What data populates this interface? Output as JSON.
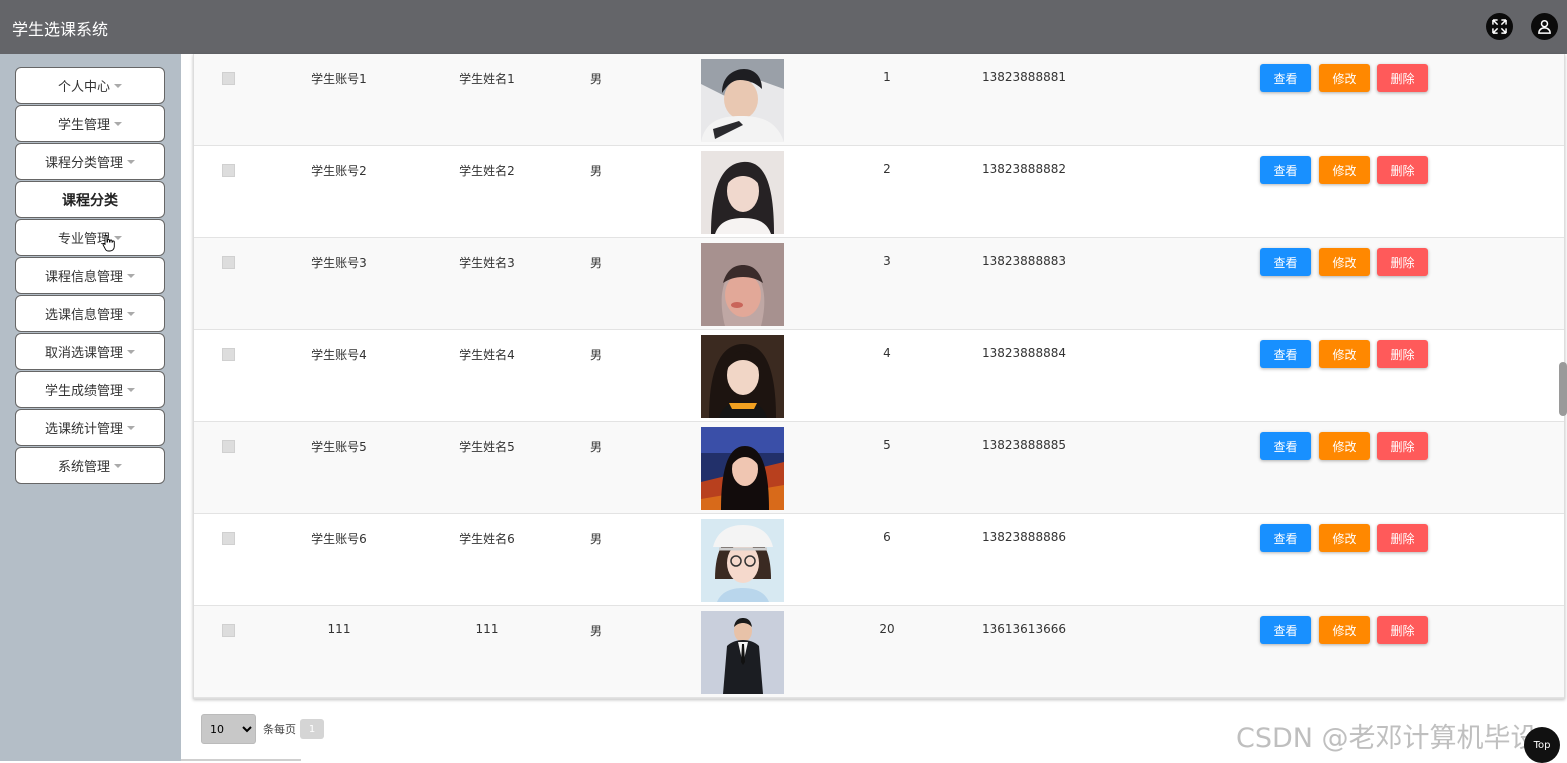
{
  "header": {
    "title": "学生选课系统",
    "fullscreen_icon": "fullscreen-icon",
    "user_icon": "user-icon"
  },
  "sidebar": {
    "items": [
      {
        "label": "个人中心",
        "has_caret": true
      },
      {
        "label": "学生管理",
        "has_caret": true
      },
      {
        "label": "课程分类管理",
        "has_caret": true
      },
      {
        "label": "课程分类",
        "has_caret": false
      },
      {
        "label": "专业管理",
        "has_caret": true
      },
      {
        "label": "课程信息管理",
        "has_caret": true
      },
      {
        "label": "选课信息管理",
        "has_caret": true
      },
      {
        "label": "取消选课管理",
        "has_caret": true
      },
      {
        "label": "学生成绩管理",
        "has_caret": true
      },
      {
        "label": "选课统计管理",
        "has_caret": true
      },
      {
        "label": "系统管理",
        "has_caret": true
      }
    ]
  },
  "table": {
    "rows": [
      {
        "account": "学生账号1",
        "name": "学生姓名1",
        "gender": "男",
        "num": "1",
        "phone": "13823888881"
      },
      {
        "account": "学生账号2",
        "name": "学生姓名2",
        "gender": "男",
        "num": "2",
        "phone": "13823888882"
      },
      {
        "account": "学生账号3",
        "name": "学生姓名3",
        "gender": "男",
        "num": "3",
        "phone": "13823888883"
      },
      {
        "account": "学生账号4",
        "name": "学生姓名4",
        "gender": "男",
        "num": "4",
        "phone": "13823888884"
      },
      {
        "account": "学生账号5",
        "name": "学生姓名5",
        "gender": "男",
        "num": "5",
        "phone": "13823888885"
      },
      {
        "account": "学生账号6",
        "name": "学生姓名6",
        "gender": "男",
        "num": "6",
        "phone": "13823888886"
      },
      {
        "account": "111",
        "name": "111",
        "gender": "男",
        "num": "20",
        "phone": "13613613666"
      }
    ],
    "actions": {
      "view": "查看",
      "edit": "修改",
      "delete": "删除"
    }
  },
  "pagination": {
    "page_size": "10",
    "per_page_label": "条每页",
    "current_page": "1"
  },
  "watermark": "CSDN @老邓计算机毕设",
  "back_to_top": "Top",
  "colors": {
    "header_bg": "#646569",
    "sidebar_bg": "#b4bec7",
    "view": "#1890ff",
    "edit": "#ff8800",
    "delete": "#ff5a5a"
  }
}
